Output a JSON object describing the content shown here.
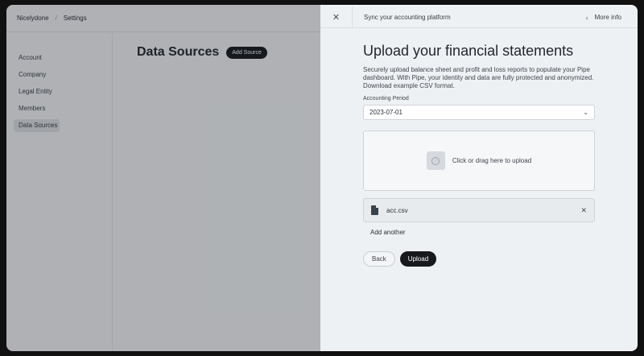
{
  "app": {
    "breadcrumb": {
      "org": "Nicelydone",
      "page": "Settings"
    },
    "sidebar": {
      "items": [
        {
          "label": "Account"
        },
        {
          "label": "Company"
        },
        {
          "label": "Legal Entity"
        },
        {
          "label": "Members"
        },
        {
          "label": "Data Sources",
          "active": true
        }
      ]
    },
    "main": {
      "title": "Data Sources",
      "add_button": "Add Source"
    }
  },
  "panel": {
    "header": {
      "title": "Sync your accounting platform",
      "more_info": "More info",
      "close_icon": "close-icon"
    },
    "heading": "Upload your financial statements",
    "description": "Securely upload balance sheet and profit and loss reports to populate your Pipe dashboard. With Pipe, your identity and data are fully protected and anonymized. Download example CSV format.",
    "period": {
      "label": "Accounting Period",
      "value": "2023-07-01"
    },
    "dropzone": {
      "text": "Click or drag here to upload",
      "icon": "upload-icon"
    },
    "file": {
      "name": "acc.csv",
      "icon": "csv-file-icon"
    },
    "add_another": "Add another",
    "buttons": {
      "back": "Back",
      "upload": "Upload"
    }
  },
  "colors": {
    "primary_button": "#17191c",
    "panel_bg": "#eef1f4"
  }
}
